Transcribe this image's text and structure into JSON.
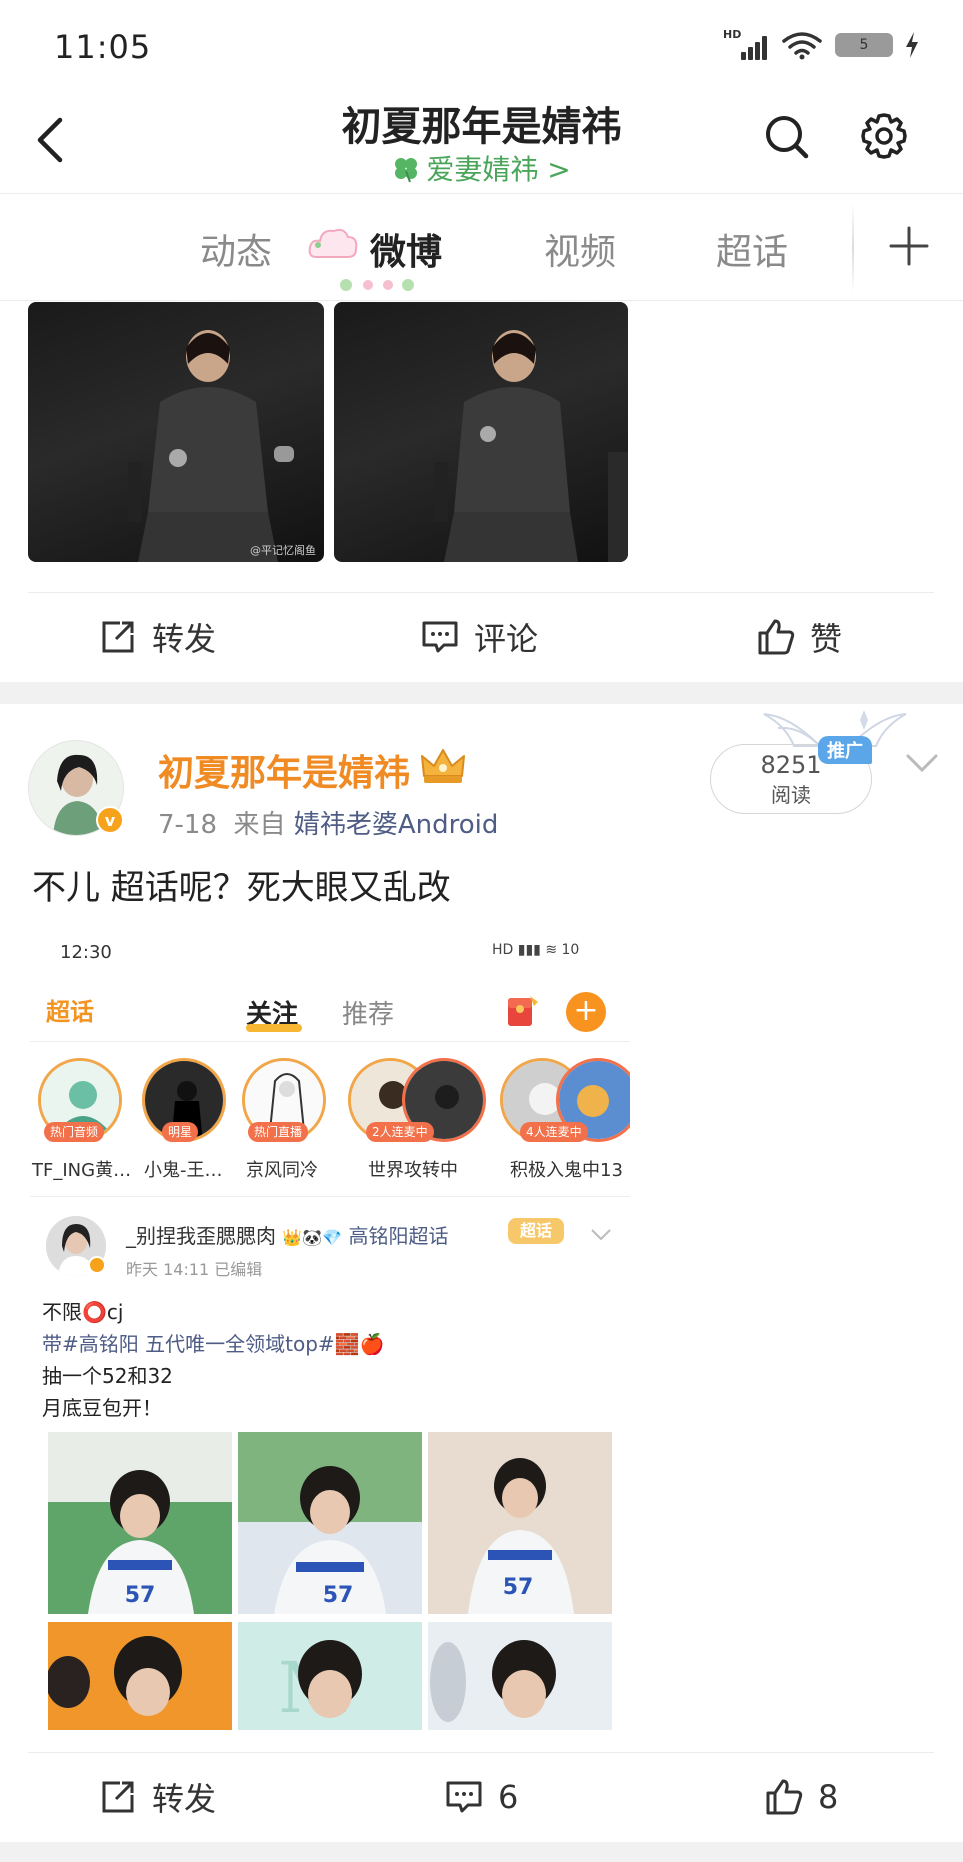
{
  "status_bar": {
    "time": "11:05",
    "signal_label": "HD",
    "battery": "5"
  },
  "header": {
    "title": "初夏那年是婧祎",
    "subtitle": "爱妻婧祎 >"
  },
  "tabs": [
    {
      "label": "动态"
    },
    {
      "label": "微博"
    },
    {
      "label": "视频"
    },
    {
      "label": "超话"
    }
  ],
  "post1": {
    "actions": {
      "repost": "转发",
      "comment": "评论",
      "like": "赞"
    },
    "image_watermark": "@平记忆阁鱼"
  },
  "post2": {
    "username": "初夏那年是婧祎",
    "date": "7-18",
    "source_prefix": "来自",
    "source": "婧祎老婆Android",
    "reads_count": "8251",
    "reads_label": "阅读",
    "promo_tag": "推广",
    "text": "不儿 超话呢？死大眼又乱改",
    "actions": {
      "repost": "转发",
      "comment_count": "6",
      "like_count": "8"
    },
    "embed": {
      "time": "12:30",
      "status": "HD ▮▮▮ ≋ 10",
      "logo": "超话",
      "tab_follow": "关注",
      "tab_recommend": "推荐",
      "add_label": "+",
      "communities": [
        {
          "tag": "热门音频",
          "label": "TF_ING黄…"
        },
        {
          "tag": "明星",
          "label": "小鬼-王…"
        },
        {
          "tag": "热门直播",
          "label": "京风同冷"
        },
        {
          "tag": "2人连麦中",
          "label": "世界攻转中"
        },
        {
          "tag": "4人连麦中",
          "label": "积极入鬼中13"
        }
      ],
      "post_username": "_别捏我歪腮腮肉",
      "post_topic": "高铭阳超话",
      "post_tag": "超话",
      "post_meta": "昨天 14:11  已编辑",
      "lines": [
        "不限⭕cj",
        "带#高铭阳 五代唯一全领域top#🧱🍎",
        "抽一个52和32",
        "月底豆包开！"
      ]
    }
  },
  "colors": {
    "accent_orange": "#f08a23",
    "link_blue": "#4e5c86",
    "clover_green": "#4aa55a",
    "promo_blue": "#5aa6e8"
  }
}
